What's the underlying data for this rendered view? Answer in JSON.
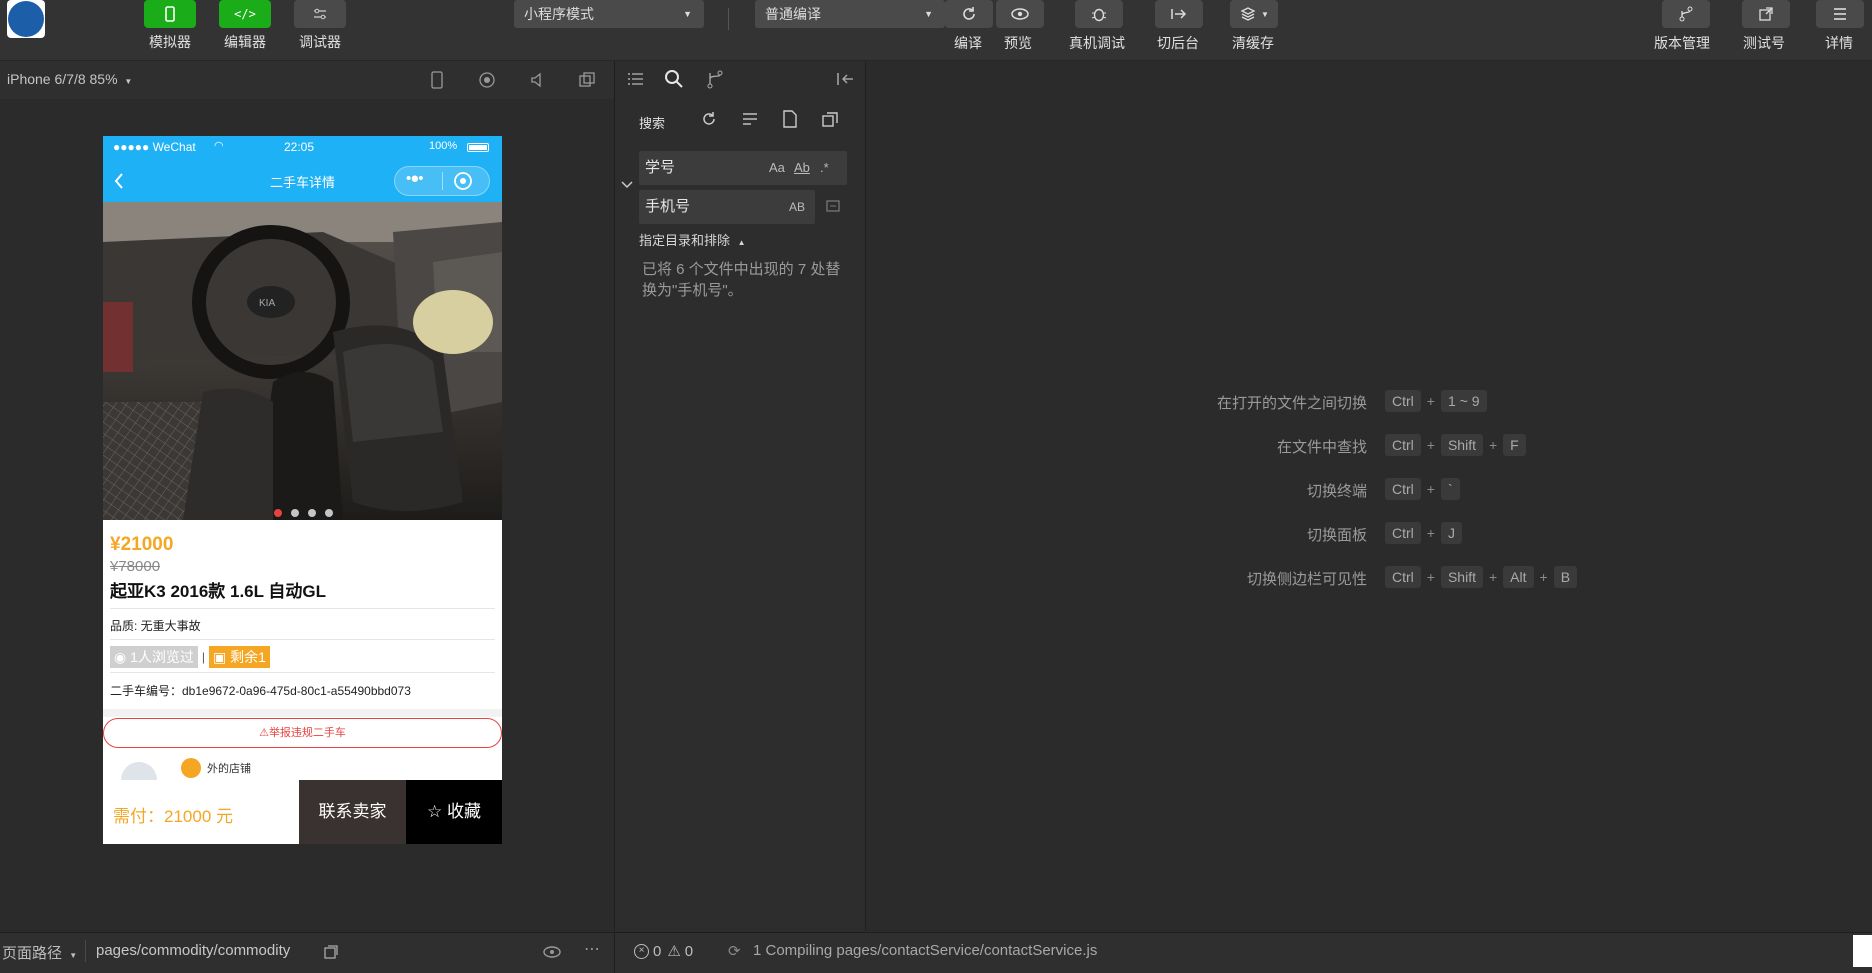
{
  "toolbar": {
    "simulator": "模拟器",
    "editor": "编辑器",
    "debugger": "调试器",
    "mode_select": "小程序模式",
    "compile_select": "普通编译",
    "compile": "编译",
    "preview": "预览",
    "device_debug": "真机调试",
    "background": "切后台",
    "clear_cache": "清缓存",
    "version_mgmt": "版本管理",
    "test_account": "测试号",
    "details": "详情"
  },
  "simulator_header": {
    "device": "iPhone 6/7/8 85%"
  },
  "phone": {
    "status_left": "●●●●● WeChat",
    "status_time": "22:05",
    "status_battery": "100%",
    "nav_title": "二手车详情",
    "price": "¥21000",
    "original_price": "¥78000",
    "car_title": "起亚K3 2016款 1.6L 自动GL",
    "quality": "品质: 无重大事故",
    "views": "1人浏览过",
    "remaining": "剩余1",
    "car_number": "二手车编号：db1e9672-0a96-475d-80c1-a55490bbd073",
    "report": "举报违规二手车",
    "seller_partial": "外的店铺",
    "need_pay": "需付：21000 元",
    "contact_seller": "联系卖家",
    "favorite": "收藏",
    "carousel_dots": 4,
    "active_dot": 0
  },
  "search_panel": {
    "label": "搜索",
    "search_value": "学号",
    "replace_value": "手机号",
    "case_toggle": "Aa",
    "word_toggle": "Ab",
    "preserve_case": "AB",
    "include_exclude": "指定目录和排除",
    "result": "已将 6 个文件中出现的 7 处替换为\"手机号\"。"
  },
  "shortcuts": [
    {
      "label": "在打开的文件之间切换",
      "keys": [
        "Ctrl",
        "1 ~ 9"
      ]
    },
    {
      "label": "在文件中查找",
      "keys": [
        "Ctrl",
        "Shift",
        "F"
      ]
    },
    {
      "label": "切换终端",
      "keys": [
        "Ctrl",
        "`"
      ]
    },
    {
      "label": "切换面板",
      "keys": [
        "Ctrl",
        "J"
      ]
    },
    {
      "label": "切换侧边栏可见性",
      "keys": [
        "Ctrl",
        "Shift",
        "Alt",
        "B"
      ]
    }
  ],
  "bottombar": {
    "page_path_label": "页面路径",
    "page_path": "pages/commodity/commodity",
    "errors": "0",
    "warnings": "0",
    "compile_status": "1 Compiling pages/contactService/contactService.js"
  },
  "colors": {
    "accent_green": "#1aad19",
    "wechat_blue": "#1fb1f5",
    "price_orange": "#f5a623",
    "report_red": "#e64340"
  }
}
